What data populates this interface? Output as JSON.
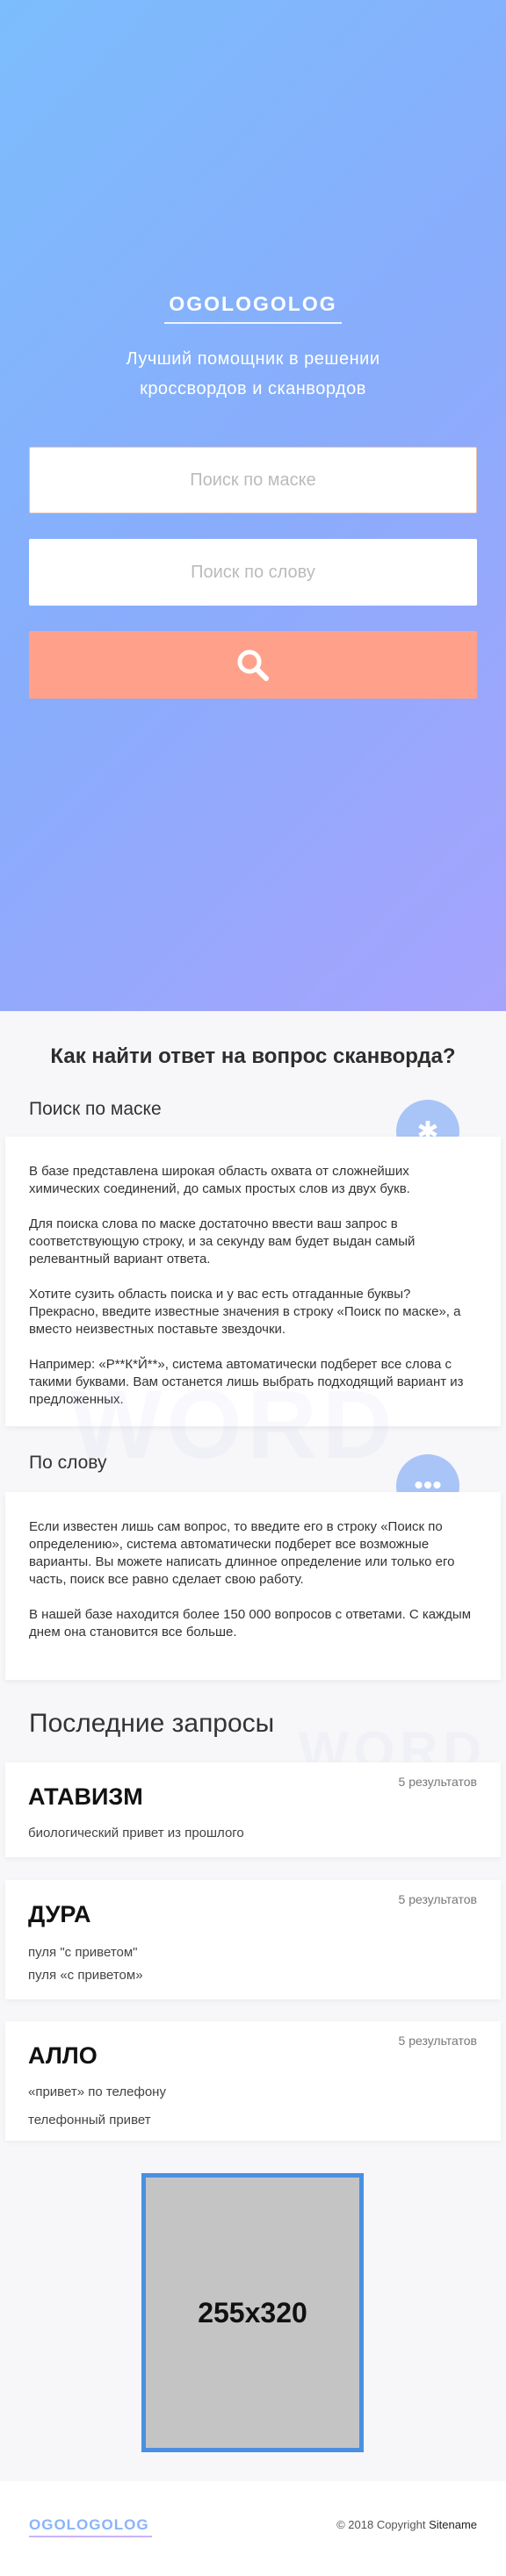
{
  "hero": {
    "logo": "OGOLOGOLOG",
    "tagline_line1": "Лучший помощник в решении",
    "tagline_line2": "кроссвордов и сканвордов",
    "mask_placeholder": "Поиск по маске",
    "word_placeholder": "Поиск по слову",
    "search_icon": "search-icon"
  },
  "howto": {
    "title": "Как найти ответ на вопрос сканворда?",
    "mask": {
      "subtitle": "Поиск по маске",
      "icon": "asterisk-icon",
      "paragraphs": [
        "В базе представлена широкая область охвата от сложнейших химических соединений, до самых простых слов из двух букв.",
        "Для поиска слова по маске достаточно ввести ваш запрос в соответствующую строку, и за секунду вам будет выдан самый релевантный вариант ответа.",
        "Хотите сузить область поиска и у вас есть отгаданные буквы? Прекрасно, введите известные значения в строку «Поиск по маске», а вместо неизвестных поставьте звездочки.",
        "Например: «Р**К*Й**», система автоматически подберет все слова с такими буквами. Вам останется лишь выбрать подходящий вариант из предложенных."
      ]
    },
    "word": {
      "subtitle": "По слову",
      "icon": "dots-icon",
      "bg_text": "WORD",
      "paragraphs": [
        "Если известен лишь сам вопрос, то введите его в строку «Поиск по определению», система автоматически подберет все возможные варианты. Вы можете написать длинное определение или только его часть, поиск все равно сделает свою работу.",
        "В нашей базе находится более 150 000 вопросов с ответами. С каждым днем она становится все больше."
      ]
    }
  },
  "recent": {
    "title": "Последние запросы",
    "bg_text": "WORD",
    "items": [
      {
        "count": "5 результатов",
        "word": "АТАВИЗМ",
        "defs": [
          "биологический привет из прошлого"
        ]
      },
      {
        "count": "5 результатов",
        "word": "ДУРА",
        "defs": [
          "пуля \"с приветом\"",
          "пуля «с приветом»"
        ]
      },
      {
        "count": "5 результатов",
        "word": "АЛЛО",
        "defs": [
          "«привет» по телефону",
          "телефонный привет"
        ]
      }
    ]
  },
  "ad": {
    "label": "255x320"
  },
  "footer": {
    "logo": "OGOLOGOLOG",
    "copyright": "© 2018 Copyright",
    "sitename": "Sitename"
  }
}
